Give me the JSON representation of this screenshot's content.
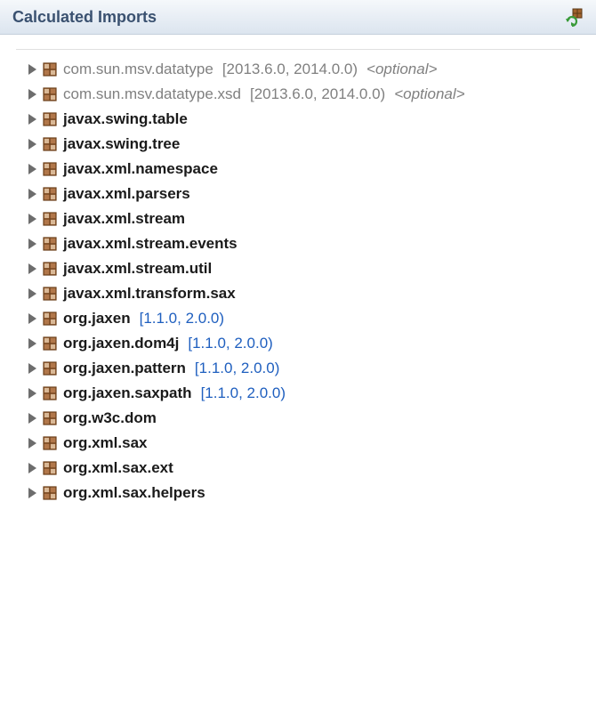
{
  "header": {
    "title": "Calculated Imports"
  },
  "imports": [
    {
      "name": "com.sun.msv.datatype",
      "version": "[2013.6.0, 2014.0.0)",
      "optional": true,
      "optionalTag": "<optional>",
      "versionStyle": "gray"
    },
    {
      "name": "com.sun.msv.datatype.xsd",
      "version": "[2013.6.0, 2014.0.0)",
      "optional": true,
      "optionalTag": "<optional>",
      "versionStyle": "gray"
    },
    {
      "name": "javax.swing.table",
      "version": "",
      "optional": false,
      "optionalTag": "",
      "versionStyle": ""
    },
    {
      "name": "javax.swing.tree",
      "version": "",
      "optional": false,
      "optionalTag": "",
      "versionStyle": ""
    },
    {
      "name": "javax.xml.namespace",
      "version": "",
      "optional": false,
      "optionalTag": "",
      "versionStyle": ""
    },
    {
      "name": "javax.xml.parsers",
      "version": "",
      "optional": false,
      "optionalTag": "",
      "versionStyle": ""
    },
    {
      "name": "javax.xml.stream",
      "version": "",
      "optional": false,
      "optionalTag": "",
      "versionStyle": ""
    },
    {
      "name": "javax.xml.stream.events",
      "version": "",
      "optional": false,
      "optionalTag": "",
      "versionStyle": ""
    },
    {
      "name": "javax.xml.stream.util",
      "version": "",
      "optional": false,
      "optionalTag": "",
      "versionStyle": ""
    },
    {
      "name": "javax.xml.transform.sax",
      "version": "",
      "optional": false,
      "optionalTag": "",
      "versionStyle": ""
    },
    {
      "name": "org.jaxen",
      "version": "[1.1.0, 2.0.0)",
      "optional": false,
      "optionalTag": "",
      "versionStyle": "blue"
    },
    {
      "name": "org.jaxen.dom4j",
      "version": "[1.1.0, 2.0.0)",
      "optional": false,
      "optionalTag": "",
      "versionStyle": "blue"
    },
    {
      "name": "org.jaxen.pattern",
      "version": "[1.1.0, 2.0.0)",
      "optional": false,
      "optionalTag": "",
      "versionStyle": "blue"
    },
    {
      "name": "org.jaxen.saxpath",
      "version": "[1.1.0, 2.0.0)",
      "optional": false,
      "optionalTag": "",
      "versionStyle": "blue"
    },
    {
      "name": "org.w3c.dom",
      "version": "",
      "optional": false,
      "optionalTag": "",
      "versionStyle": ""
    },
    {
      "name": "org.xml.sax",
      "version": "",
      "optional": false,
      "optionalTag": "",
      "versionStyle": ""
    },
    {
      "name": "org.xml.sax.ext",
      "version": "",
      "optional": false,
      "optionalTag": "",
      "versionStyle": ""
    },
    {
      "name": "org.xml.sax.helpers",
      "version": "",
      "optional": false,
      "optionalTag": "",
      "versionStyle": ""
    }
  ]
}
